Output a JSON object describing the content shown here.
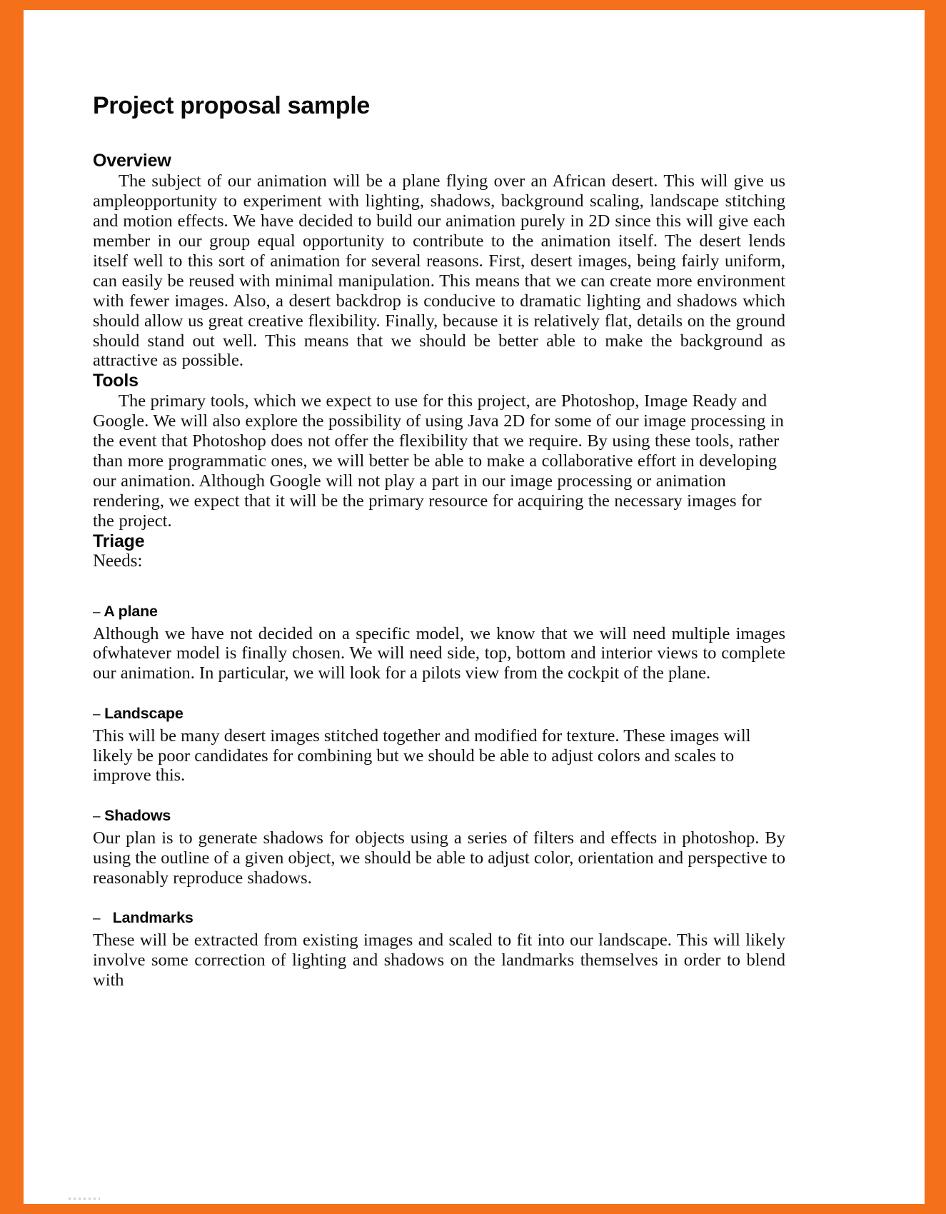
{
  "document": {
    "title": "Project proposal sample",
    "sections": [
      {
        "id": "overview",
        "heading": "Overview",
        "paragraph": "The subject of our animation will be a plane flying over an African desert. This will give us ampleopportunity to experiment with lighting, shadows, background scaling, landscape stitching and motion effects. We have decided to build our animation purely in 2D since this will give each member in our group equal opportunity to contribute to the animation itself. The desert lends itself well to this sort of animation for several reasons. First, desert images, being fairly uniform, can easily be reused with minimal manipulation. This means that we can create more environment with fewer images. Also, a desert backdrop is conducive to dramatic lighting and shadows which should allow us great creative flexibility. Finally, because it is relatively flat, details on the ground should stand out well. This means that we should be better able to make the background as attractive as possible."
      },
      {
        "id": "tools",
        "heading": "Tools",
        "paragraph": "The primary tools, which we expect to use for this project, are Photoshop, Image Ready and Google. We will also explore the possibility of using Java 2D for some of our image processing in the event that Photoshop does not offer the flexibility that we require. By using these tools, rather than more programmatic ones, we will better be able to make a collaborative effort in developing our animation. Although Google will not play a part in our image processing or animation rendering, we expect that it will be the primary resource for acquiring the necessary images for the project."
      },
      {
        "id": "triage",
        "heading": "Triage",
        "needs_label": "Needs:",
        "needs": [
          {
            "dash": "–",
            "dash_gap": " ",
            "title": "A plane",
            "body": "Although we have not decided on a specific model, we know that we will need multiple images ofwhatever model is finally chosen. We will need side, top, bottom and interior views to complete our animation. In particular, we will look for a pilots view from the cockpit of the plane."
          },
          {
            "dash": "–",
            "dash_gap": " ",
            "title": "Landscape",
            "body": "This will be many desert images stitched together and modified for texture. These images will likely be poor candidates for combining but we should be able to adjust colors and scales to improve this."
          },
          {
            "dash": "–",
            "dash_gap": " ",
            "title": "Shadows",
            "body": "Our plan is to generate shadows for objects using a series of filters and effects in photoshop. By using the outline of a given object, we should be able to adjust color, orientation and perspective to reasonably reproduce shadows."
          },
          {
            "dash": "–",
            "dash_gap": "   ",
            "title": "Landmarks",
            "body": "These will be extracted from existing images and scaled to fit into our landscape. This will likely involve some correction of lighting and shadows on the landmarks themselves in order to blend with"
          }
        ]
      }
    ]
  },
  "colors": {
    "border": "#f4701b",
    "page": "#ffffff",
    "text": "#111111"
  }
}
